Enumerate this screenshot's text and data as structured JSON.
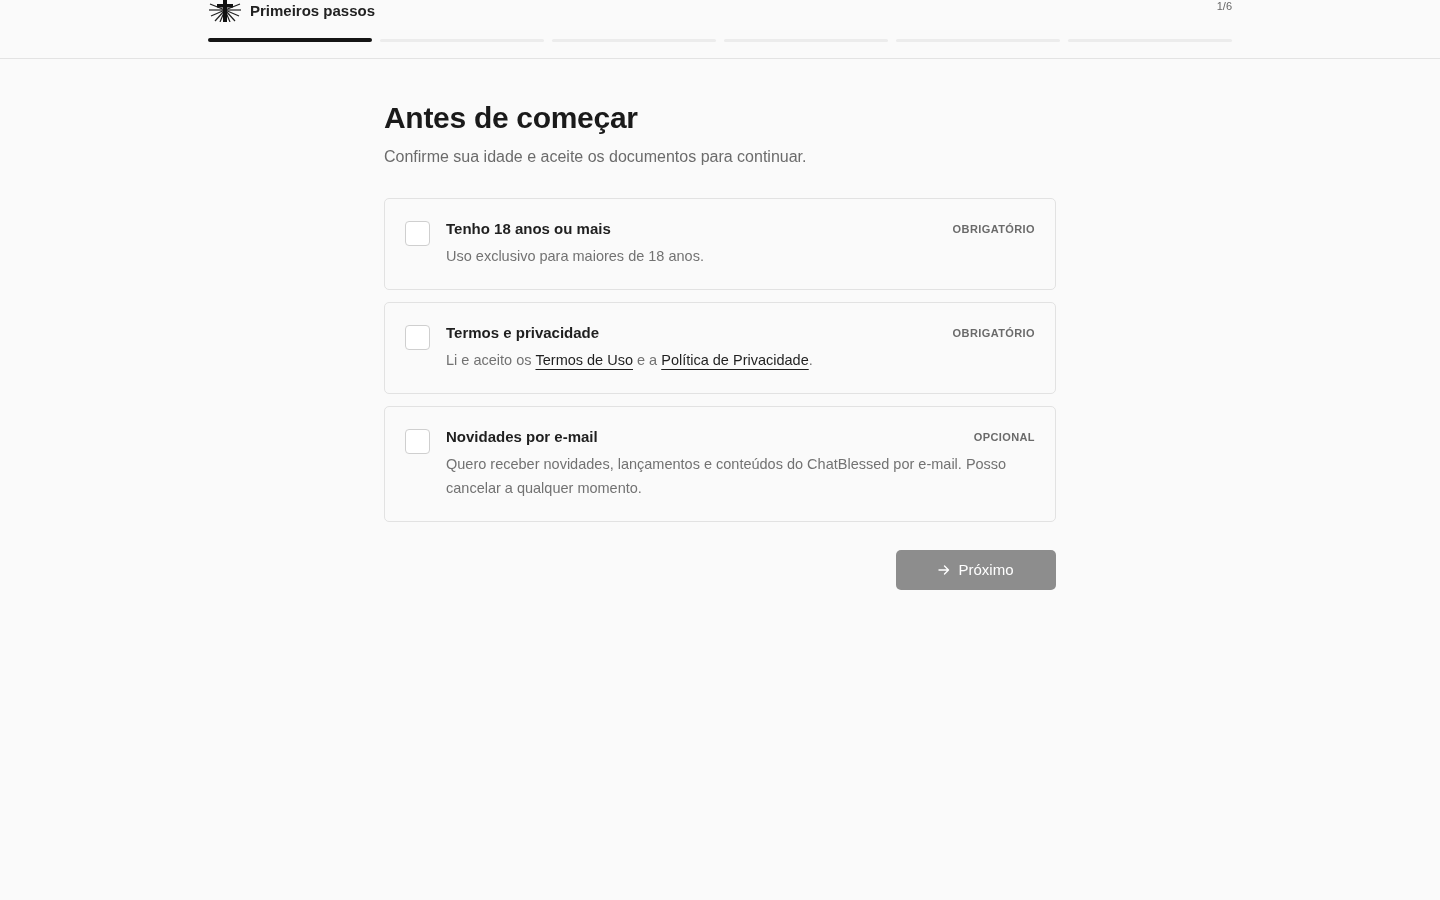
{
  "header": {
    "title": "Primeiros passos",
    "step_counter": "1/6",
    "steps": [
      {
        "active": true
      },
      {
        "active": false
      },
      {
        "active": false
      },
      {
        "active": false
      },
      {
        "active": false
      },
      {
        "active": false
      }
    ]
  },
  "heading": "Antes de começar",
  "subheading": "Confirme sua idade e aceite os documentos para continuar.",
  "options": [
    {
      "title": "Tenho 18 anos ou mais",
      "tag": "OBRIGATÓRIO",
      "checked": false,
      "description": [
        {
          "kind": "text",
          "text": "Uso exclusivo para maiores de 18 anos."
        }
      ]
    },
    {
      "title": "Termos e privacidade",
      "tag": "OBRIGATÓRIO",
      "checked": false,
      "description": [
        {
          "kind": "text",
          "text": "Li e aceito os "
        },
        {
          "kind": "link",
          "text": "Termos de Uso"
        },
        {
          "kind": "text",
          "text": " e a "
        },
        {
          "kind": "link",
          "text": "Política de Privacidade"
        },
        {
          "kind": "text",
          "text": "."
        }
      ]
    },
    {
      "title": "Novidades por e-mail",
      "tag": "OPCIONAL",
      "checked": false,
      "description": [
        {
          "kind": "text",
          "text": "Quero receber novidades, lançamentos e conteúdos do ChatBlessed por e-mail. Posso cancelar a qualquer momento."
        }
      ]
    }
  ],
  "next_button": {
    "label": "Próximo",
    "disabled": true
  }
}
